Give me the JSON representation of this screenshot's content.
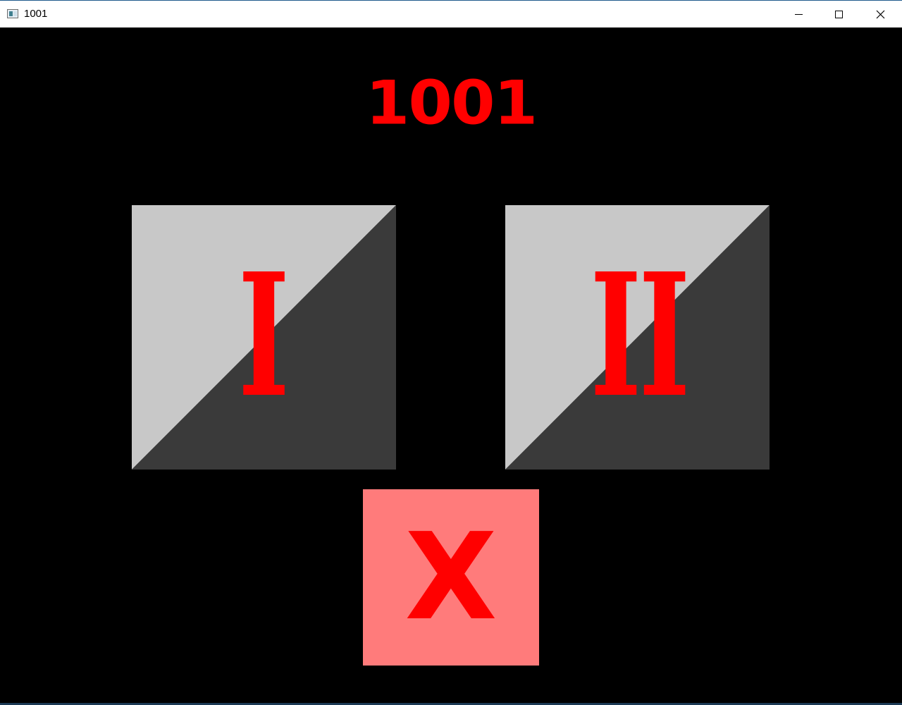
{
  "window": {
    "title": "1001",
    "controls": {
      "minimize_icon": "minimize-icon",
      "maximize_icon": "maximize-icon",
      "close_icon": "close-icon"
    }
  },
  "game": {
    "title": "1001",
    "colors": {
      "background": "#000000",
      "title_red": "#ff0000",
      "tile_light": "#c8c8c8",
      "tile_dark": "#3a3a3a",
      "exit_tile": "#ff7b7b"
    },
    "menu": {
      "option_one_label": "I",
      "option_two_label": "II",
      "exit_label": "X"
    }
  }
}
